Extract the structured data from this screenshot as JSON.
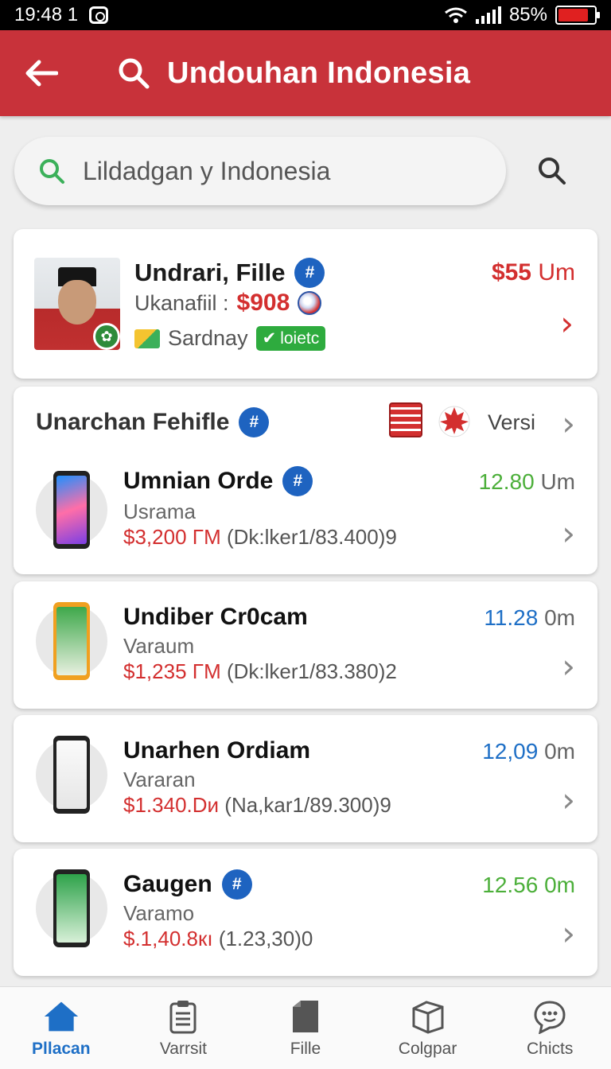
{
  "status_bar": {
    "time": "19:48 1",
    "battery_pct": "85%",
    "battery_level": 0.85
  },
  "header": {
    "title": "Undouhan Indonesia"
  },
  "search": {
    "placeholder": "Lildadgan y Indonesia"
  },
  "profile": {
    "name": "Undrari, Fille",
    "sub_label": "Ukanafiil :",
    "sub_price": "$908",
    "tag_text": "Sardnay",
    "badge_text": "loietc",
    "amount": "$55",
    "amount_unit": "Um"
  },
  "section": {
    "title": "Unarchan Fehifle",
    "version_label": "Versi"
  },
  "items": [
    {
      "name": "Umnian Orde",
      "verified": true,
      "sub": "Usrama",
      "price": "$3,200 ΓM",
      "detail": "(Dk:lker1/83.400)9",
      "value": "12.80",
      "unit": "Um",
      "value_color": "#4caf3a",
      "screen": "linear-gradient(160deg,#1e90ff,#ff6ea8,#7b3fe4)"
    },
    {
      "name": "Undiber Cr0cam",
      "verified": false,
      "sub": "Varaum",
      "price": "$1,235 ΓM",
      "detail": "(Dk:lker1/83.380)2",
      "value": "11.28",
      "unit": "0m",
      "value_color": "#1e6fc6",
      "screen": "linear-gradient(180deg,#3ea84a,#e8f0e0)"
    },
    {
      "name": "Unarhen Ordiam",
      "verified": false,
      "sub": "Vararan",
      "price": "$1.340.Dи",
      "detail": "(Na,kar1/89.300)9",
      "value": "12,09",
      "unit": "0m",
      "value_color": "#1e6fc6",
      "screen": "linear-gradient(180deg,#fafafa,#e6e6e6)"
    },
    {
      "name": "Gaugen",
      "verified": true,
      "sub": "Varamo",
      "price": "$.1,40.8кı",
      "detail": "(1.23,30)0",
      "value": "12.56 0m",
      "unit": "",
      "value_color": "#4caf3a",
      "screen": "linear-gradient(180deg,#2ea24a,#d8f0d8)"
    }
  ],
  "nav": [
    {
      "label": "Pllacan",
      "icon": "home-icon",
      "active": true
    },
    {
      "label": "Varrsit",
      "icon": "clipboard-icon",
      "active": false
    },
    {
      "label": "Fille",
      "icon": "file-icon",
      "active": false
    },
    {
      "label": "Colgpar",
      "icon": "box-icon",
      "active": false
    },
    {
      "label": "Chicts",
      "icon": "chat-icon",
      "active": false
    }
  ],
  "colors": {
    "brand_red": "#c8323a",
    "price_red": "#d32f2f",
    "green": "#4caf3a",
    "blue": "#1e6fc6"
  }
}
